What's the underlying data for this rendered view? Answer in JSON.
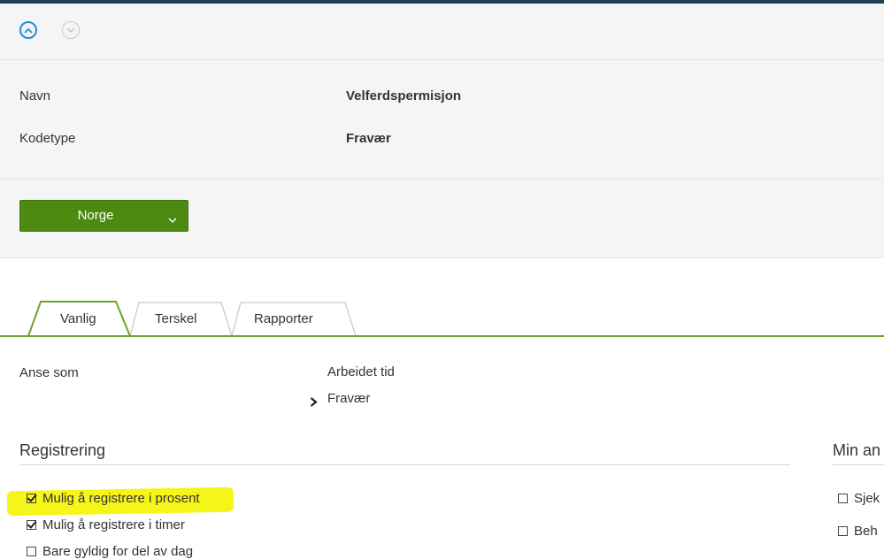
{
  "nav": {
    "up_icon": "chevron-up-circle-icon",
    "down_icon": "chevron-down-circle-icon"
  },
  "info": {
    "navn_label": "Navn",
    "navn_value": "Velferdspermisjon",
    "kodetype_label": "Kodetype",
    "kodetype_value": "Fravær"
  },
  "country": {
    "label": "Norge",
    "icon": "chevron-down-icon"
  },
  "tabs": [
    {
      "label": "Vanlig",
      "active": true
    },
    {
      "label": "Terskel",
      "active": false
    },
    {
      "label": "Rapporter",
      "active": false
    }
  ],
  "anse": {
    "label": "Anse som",
    "option1": "Arbeidet tid",
    "option2": "Fravær"
  },
  "registrering": {
    "heading": "Registrering",
    "items": [
      {
        "label": "Mulig å registrere i prosent",
        "checked": true
      },
      {
        "label": "Mulig å registrere i timer",
        "checked": true
      },
      {
        "label": "Bare gyldig for del av dag",
        "checked": false
      }
    ]
  },
  "right_section": {
    "heading": "Min an",
    "items": [
      {
        "label": "Sjek",
        "checked": false
      },
      {
        "label": "Beh",
        "checked": false
      }
    ]
  },
  "colors": {
    "accent_green": "#4c8a12",
    "tab_line": "#6aa52a",
    "highlight": "#f5f51a",
    "link_blue": "#1d8fd6"
  }
}
